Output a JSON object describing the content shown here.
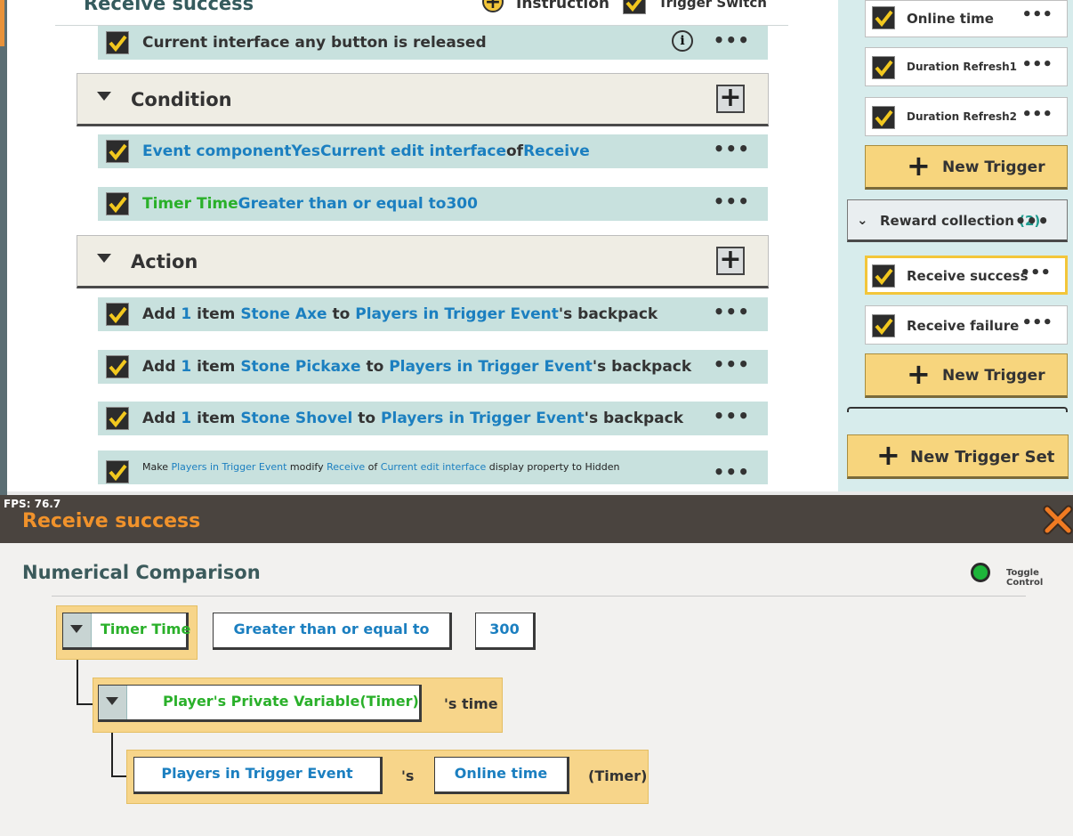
{
  "editor": {
    "header": {
      "title": "Receive success",
      "instruction_label": "Instruction",
      "trigger_switch_label": "Trigger Switch"
    },
    "event_row": {
      "text": "Current interface any button is released"
    },
    "condition_section": {
      "label": "Condition"
    },
    "condition_rows": [
      {
        "p1": "Event componentYesCurrent edit interface",
        "p2": "of",
        "p3": "Receive"
      },
      {
        "p1": "Timer Time",
        "p2": "Greater than or equal to",
        "p3": "300"
      }
    ],
    "action_section": {
      "label": "Action"
    },
    "action_rows": [
      {
        "a": "Add ",
        "n": "1",
        "b": " item ",
        "item": "Stone Axe",
        "c": " to ",
        "target": "Players in Trigger Event",
        "d": "'s backpack"
      },
      {
        "a": "Add ",
        "n": "1",
        "b": " item ",
        "item": "Stone Pickaxe",
        "c": " to ",
        "target": "Players in Trigger Event",
        "d": "'s backpack"
      },
      {
        "a": "Add ",
        "n": "1",
        "b": " item ",
        "item": "Stone Shovel",
        "c": " to ",
        "target": "Players in Trigger Event",
        "d": "'s backpack"
      }
    ],
    "last_action": {
      "a": "Make ",
      "who": "Players in Trigger Event",
      "b": " modify ",
      "what": "Receive",
      "c": " of ",
      "where": "Current edit interface",
      "d": " display property to Hidden"
    },
    "dots": "•••"
  },
  "sidebar": {
    "items_top": [
      {
        "label": "Online time"
      },
      {
        "label": "Duration Refresh1"
      },
      {
        "label": "Duration Refresh2"
      }
    ],
    "new_trigger_label": "New Trigger",
    "group": {
      "label": "Reward collection",
      "count": "(2)"
    },
    "items_group": [
      {
        "label": "Receive success",
        "selected": true
      },
      {
        "label": "Receive failure"
      }
    ],
    "new_trigger_set_label": "New Trigger Set"
  },
  "fps": "FPS: 76.7",
  "dialog": {
    "title": "Receive success",
    "subheading": "Numerical Comparison",
    "toggle_label": "Toggle Control",
    "row1": {
      "left": "Timer Time",
      "op": "Greater than or equal to",
      "value": "300"
    },
    "row2": {
      "variable": "Player's Private Variable(Timer)",
      "suffix": "'s time"
    },
    "row3": {
      "player": "Players in Trigger Event",
      "poss": "'s",
      "field": "Online time",
      "suffix": "(Timer)"
    }
  },
  "colors": {
    "accent_orange": "#f0922b",
    "link_blue": "#1b7fc0",
    "value_green": "#2ab02a",
    "button_yellow": "#f7d57d"
  }
}
